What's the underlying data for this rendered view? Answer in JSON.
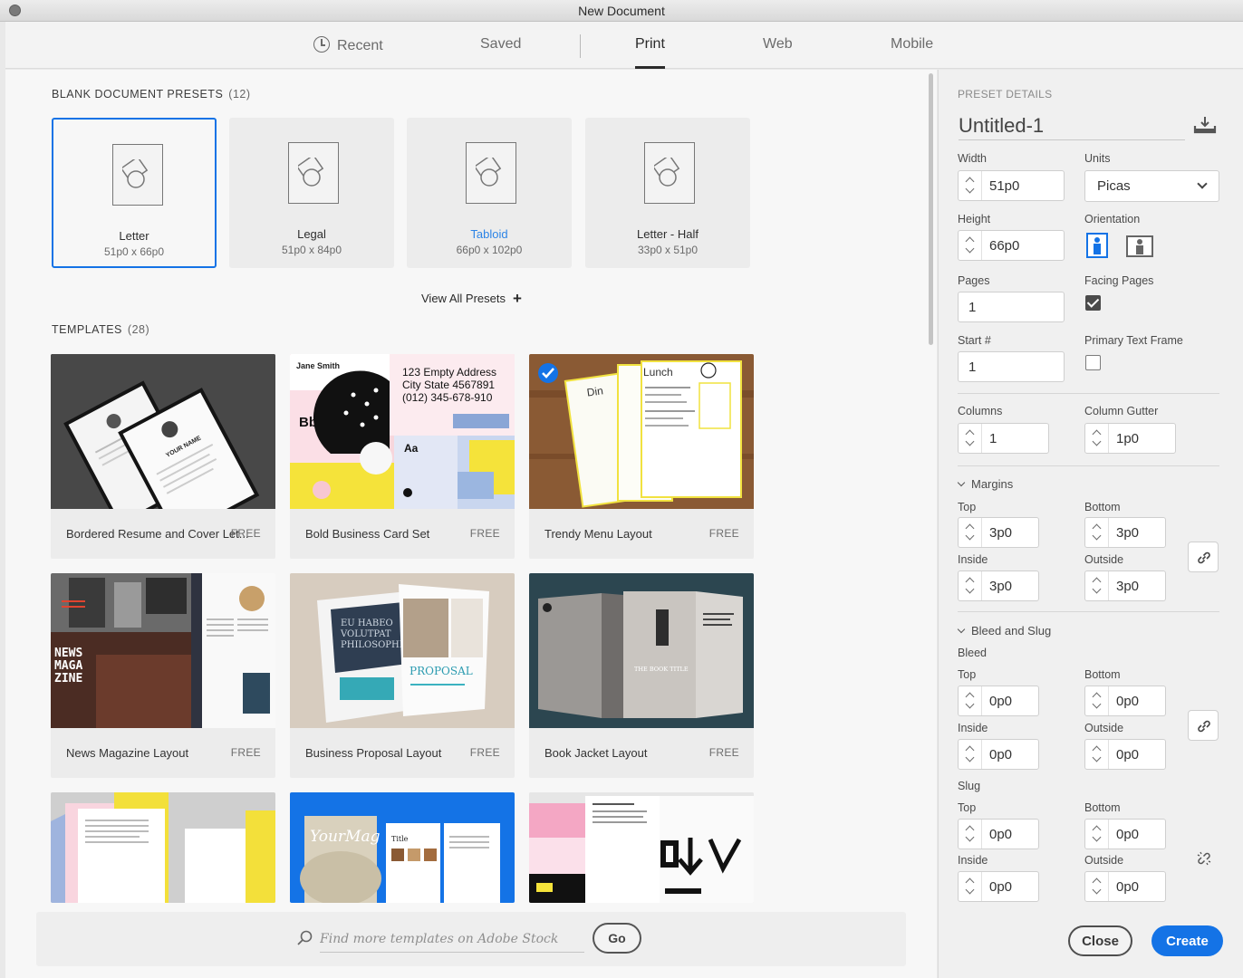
{
  "window": {
    "title": "New Document"
  },
  "tabs": [
    {
      "label": "Recent"
    },
    {
      "label": "Saved"
    },
    {
      "label": "Print"
    },
    {
      "label": "Web"
    },
    {
      "label": "Mobile"
    }
  ],
  "presets": {
    "title": "BLANK DOCUMENT PRESETS",
    "count": "(12)",
    "items": [
      {
        "name": "Letter",
        "size": "51p0 x 66p0"
      },
      {
        "name": "Legal",
        "size": "51p0 x 84p0"
      },
      {
        "name": "Tabloid",
        "size": "66p0 x 102p0"
      },
      {
        "name": "Letter - Half",
        "size": "33p0 x 51p0"
      }
    ],
    "view_all": "View All Presets"
  },
  "templates": {
    "title": "TEMPLATES",
    "count": "(28)",
    "items": [
      {
        "name": "Bordered Resume and Cover Let...",
        "badge": "FREE"
      },
      {
        "name": "Bold Business Card Set",
        "badge": "FREE"
      },
      {
        "name": "Trendy Menu Layout",
        "badge": "FREE"
      },
      {
        "name": "News Magazine Layout",
        "badge": "FREE"
      },
      {
        "name": "Business Proposal Layout",
        "badge": "FREE"
      },
      {
        "name": "Book Jacket Layout",
        "badge": "FREE"
      }
    ],
    "thumb_text": {
      "resume_name": "YOUR NAME",
      "card_name": "Jane Smith",
      "card_bb": "Bb",
      "card_aa": "Aa",
      "card_address": [
        "123 Empty Address",
        "City State 4567891",
        "(012) 345-678-910"
      ],
      "menu_din": "Din",
      "menu_lunch": "Lunch",
      "news_title": [
        "NEWS",
        "MAGA",
        "ZINE"
      ],
      "proposal_heading": [
        "EU HABEO",
        "VOLUTPAT",
        "PHILOSOPHIA"
      ],
      "proposal_word": "PROPOSAL",
      "book_title": "THE BOOK TITLE",
      "yourmag": "YourMag",
      "mag_title": "Title"
    }
  },
  "search": {
    "placeholder": "Find more templates on Adobe Stock",
    "go": "Go"
  },
  "details": {
    "heading": "PRESET DETAILS",
    "doc_name": "Untitled-1",
    "width_label": "Width",
    "width": "51p0",
    "units_label": "Units",
    "units": "Picas",
    "height_label": "Height",
    "height": "66p0",
    "orientation_label": "Orientation",
    "pages_label": "Pages",
    "pages": "1",
    "facing_label": "Facing Pages",
    "start_label": "Start #",
    "start": "1",
    "primary_label": "Primary Text Frame",
    "columns_label": "Columns",
    "columns": "1",
    "gutter_label": "Column Gutter",
    "gutter": "1p0",
    "margins": {
      "label": "Margins",
      "top_label": "Top",
      "top": "3p0",
      "bottom_label": "Bottom",
      "bottom": "3p0",
      "inside_label": "Inside",
      "inside": "3p0",
      "outside_label": "Outside",
      "outside": "3p0"
    },
    "bleed_slug": {
      "label": "Bleed and Slug",
      "bleed_label": "Bleed",
      "slug_label": "Slug",
      "top_label": "Top",
      "bottom_label": "Bottom",
      "inside_label": "Inside",
      "outside_label": "Outside",
      "bleed_top": "0p0",
      "bleed_bottom": "0p0",
      "bleed_inside": "0p0",
      "bleed_outside": "0p0",
      "slug_top": "0p0",
      "slug_bottom": "0p0",
      "slug_inside": "0p0",
      "slug_outside": "0p0"
    },
    "close": "Close",
    "create": "Create"
  },
  "colors": {
    "accent": "#1473e6"
  }
}
